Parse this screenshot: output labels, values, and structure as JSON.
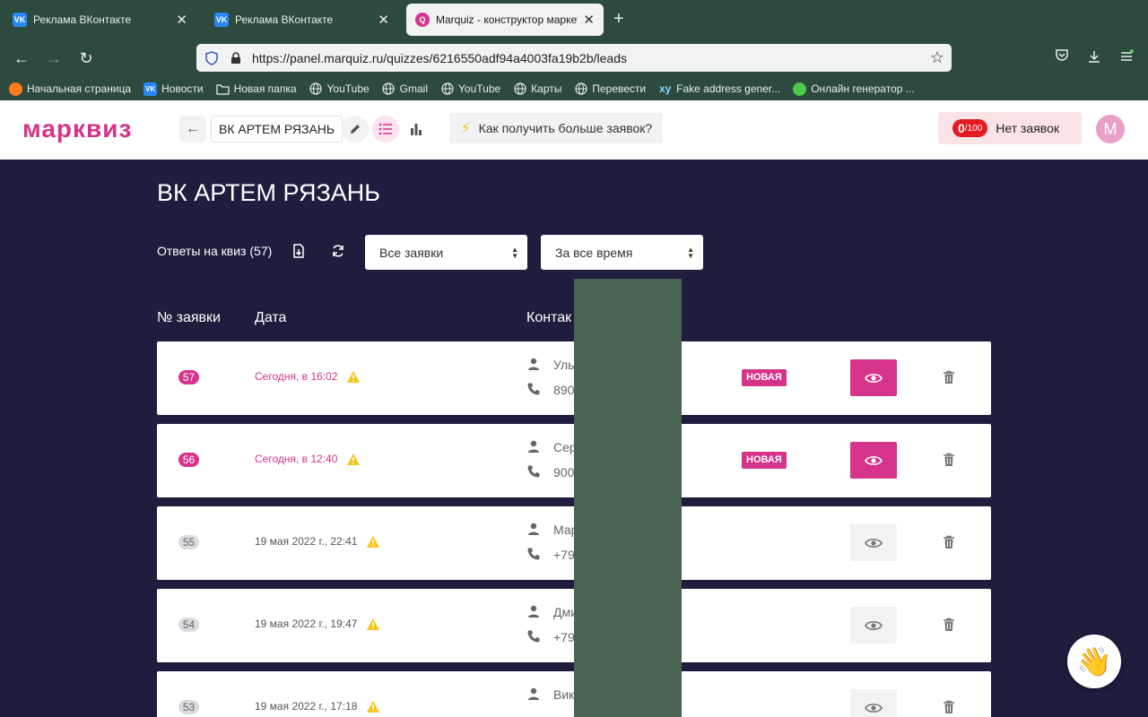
{
  "browser": {
    "tabs": [
      {
        "title": "Реклама ВКонтакте",
        "favicon": "VK",
        "active": false
      },
      {
        "title": "Реклама ВКонтакте",
        "favicon": "VK",
        "active": false
      },
      {
        "title": "Marquiz - конструктор маркети",
        "favicon": "Q",
        "active": true
      }
    ],
    "url": "https://panel.marquiz.ru/quizzes/6216550adf94a4003fa19b2b/leads",
    "bookmarks": [
      {
        "label": "Начальная страница",
        "icon": "firefox-icon"
      },
      {
        "label": "Новости",
        "icon": "vk-icon"
      },
      {
        "label": "Новая папка",
        "icon": "folder-icon"
      },
      {
        "label": "YouTube",
        "icon": "globe-icon"
      },
      {
        "label": "Gmail",
        "icon": "globe-icon"
      },
      {
        "label": "YouTube",
        "icon": "globe-icon"
      },
      {
        "label": "Карты",
        "icon": "globe-icon"
      },
      {
        "label": "Перевести",
        "icon": "globe-icon"
      },
      {
        "label": "Fake address gener...",
        "icon": "xy-icon"
      },
      {
        "label": "Онлайн генератор ...",
        "icon": "green-dot-icon"
      }
    ]
  },
  "header": {
    "logo": "марквиз",
    "quiz_name": "ВК АРТЕМ РЯЗАНЬ",
    "tip": "Как получить больше заявок?",
    "leads_count": "0",
    "leads_limit": "/100",
    "leads_text": "Нет заявок",
    "avatar_letter": "M"
  },
  "main": {
    "title": "ВК АРТЕМ РЯЗАНЬ",
    "answers_label": "Ответы на квиз (57)",
    "filter_status": "Все заявки",
    "filter_period": "За все время",
    "columns": {
      "num": "№ заявки",
      "date": "Дата",
      "contacts": "Контак"
    },
    "rows": [
      {
        "num": "57",
        "date": "Сегодня, в 16:02",
        "name": "Уль",
        "phone": "890",
        "status": "НОВАЯ",
        "is_new": true
      },
      {
        "num": "56",
        "date": "Сегодня, в 12:40",
        "name": "Сер",
        "phone": "900",
        "status": "НОВАЯ",
        "is_new": true
      },
      {
        "num": "55",
        "date": "19 мая 2022 г., 22:41",
        "name": "Мар",
        "phone": "+79",
        "status": "",
        "is_new": false
      },
      {
        "num": "54",
        "date": "19 мая 2022 г., 19:47",
        "name": "Дми",
        "phone": "+79",
        "status": "",
        "is_new": false
      },
      {
        "num": "53",
        "date": "19 мая 2022 г., 17:18",
        "name": "Вик",
        "phone": "",
        "status": "",
        "is_new": false
      }
    ]
  },
  "colors": {
    "brand": "#d6338a",
    "chrome": "#2d4a3e",
    "page_bg": "#1e1d3e"
  }
}
